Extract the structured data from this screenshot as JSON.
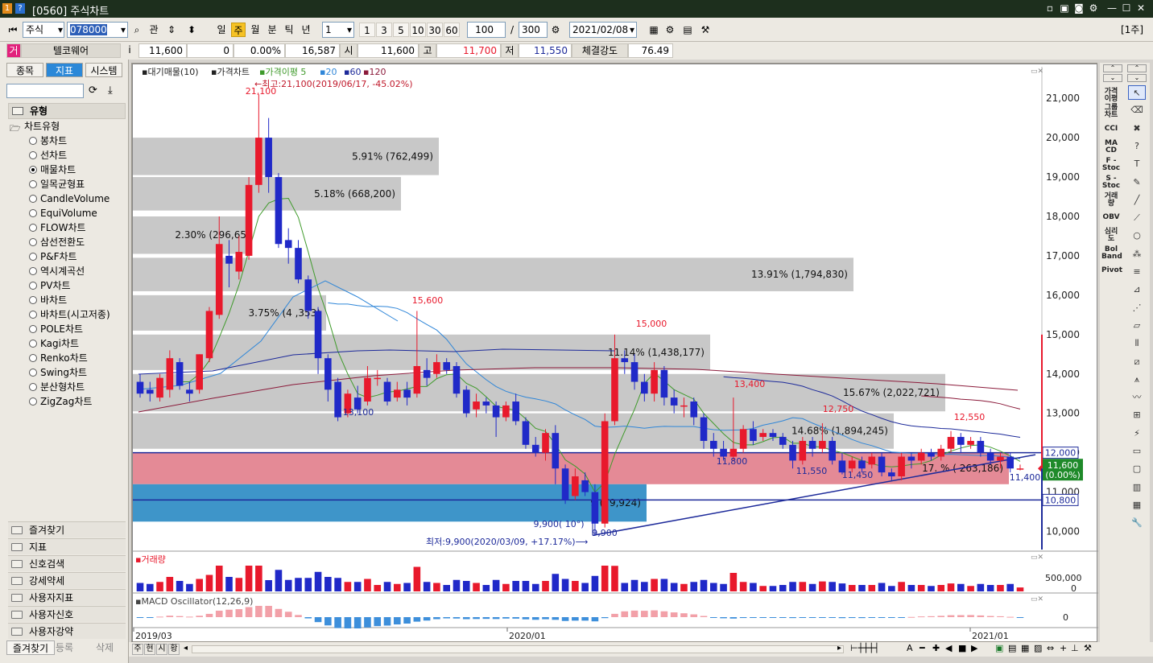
{
  "window": {
    "title": "[0560] 주식차트"
  },
  "toolbar": {
    "market": "주식",
    "code": "078000",
    "btn_gwan": "관",
    "periods": [
      "일",
      "주",
      "월",
      "분",
      "틱",
      "년"
    ],
    "active_period": "주",
    "interval": "1",
    "quick_intervals": [
      "1",
      "3",
      "5",
      "10",
      "30",
      "60"
    ],
    "count": "100",
    "total": "300",
    "date": "2021/02/08",
    "right_tag": "[1주]"
  },
  "quote": {
    "badge": "거",
    "name": "텔코웨어",
    "info": "i",
    "price": "11,600",
    "change": "0",
    "rate": "0.00%",
    "volume": "16,587",
    "open_label": "시",
    "open": "11,600",
    "high_label": "고",
    "high": "11,700",
    "low_label": "저",
    "low": "11,550",
    "strength_label": "체결강도",
    "strength": "76.49"
  },
  "left": {
    "tabs": [
      "종목",
      "지표",
      "시스템"
    ],
    "active_tab": "지표",
    "section": "유형",
    "group": "차트유형",
    "types": [
      "봉차트",
      "선차트",
      "매물차트",
      "일목균형표",
      "CandleVolume",
      "EquiVolume",
      "FLOW차트",
      "삼선전환도",
      "P&F차트",
      "역시계곡선",
      "PV차트",
      "바차트",
      "바차트(시고저종)",
      "POLE차트",
      "Kagi차트",
      "Renko차트",
      "Swing차트",
      "분산형차트",
      "ZigZag차트"
    ],
    "selected_type": "매물차트",
    "accordions": [
      "즐겨찾기",
      "지표",
      "신호검색",
      "강세약세",
      "사용자지표",
      "사용자신호",
      "사용자강약"
    ],
    "bottom_tabs": [
      "즐겨찾기",
      "등록",
      "삭제"
    ]
  },
  "chart": {
    "legend": [
      "▪대기매물(10)",
      "▪가격차트",
      "▪가격이평 5",
      "▪20",
      "▪60",
      "▪120"
    ],
    "max_note": "←최고:21,100(2019/06/17, -45.02%)",
    "min_note": "최저:9,900(2020/03/09, +17.17%)⟶",
    "y_ticks": [
      "21,000",
      "20,000",
      "19,000",
      "18,000",
      "17,000",
      "16,000",
      "15,000",
      "14,000",
      "13,000",
      "12,000",
      "11,000",
      "10,000"
    ],
    "x_ticks": [
      "2019/03",
      "2020/01",
      "2021/01"
    ],
    "price_tags": {
      "top": "12,000",
      "cur": "11,600",
      "cur_rate": "(0.00%)",
      "low": "10,800"
    },
    "volume_title": "▪거래량",
    "volume_ticks": [
      "500,000",
      "0"
    ],
    "macd_title": "▪MACD Oscillator(12,26,9)",
    "macd_tick": "0",
    "profile": [
      {
        "label": "5.91% (762,499)"
      },
      {
        "label": "5.18% (668,200)"
      },
      {
        "label": "2.30% (296,65"
      },
      {
        "label": "13.91% (1,794,830)"
      },
      {
        "label": "3.75% (4 ,353)"
      },
      {
        "label": "11.14% (1,438,177)"
      },
      {
        "label": "15.67% (2,022,721)"
      },
      {
        "label": "14.68% (1,894,245)"
      },
      {
        "label": "17.  % ( 263,186)"
      },
      {
        "label": "9  (79,924)"
      }
    ],
    "annotations": [
      "21,100",
      "15,600",
      "15,000",
      "13,400",
      "12,750",
      "12,550",
      "13,100",
      "11,800",
      "11,550",
      "11,450",
      "11,400",
      "9,900( 10°)",
      "9,900"
    ],
    "colors": {
      "up": "#e8192c",
      "down": "#2029c8",
      "ma5": "#3f9a2b",
      "ma20": "#2f86d8",
      "ma60": "#1d2a9a",
      "ma120": "#8b1a3a"
    }
  },
  "chart_data": {
    "type": "candlestick",
    "title": "",
    "ylim": [
      9500,
      21800
    ],
    "candles": [
      {
        "o": 13800,
        "c": 13500,
        "h": 14000,
        "l": 13400
      },
      {
        "o": 13600,
        "c": 13500,
        "h": 13800,
        "l": 13300
      },
      {
        "o": 13400,
        "c": 13900,
        "h": 14000,
        "l": 13300
      },
      {
        "o": 13600,
        "c": 14400,
        "h": 14600,
        "l": 13400
      },
      {
        "o": 14300,
        "c": 13700,
        "h": 14400,
        "l": 13600
      },
      {
        "o": 13600,
        "c": 13500,
        "h": 13800,
        "l": 13300
      },
      {
        "o": 13600,
        "c": 14500,
        "h": 14500,
        "l": 13500
      },
      {
        "o": 14400,
        "c": 15600,
        "h": 15700,
        "l": 14300
      },
      {
        "o": 15500,
        "c": 17300,
        "h": 18000,
        "l": 15400
      },
      {
        "o": 17000,
        "c": 16800,
        "h": 17400,
        "l": 16200
      },
      {
        "o": 16600,
        "c": 17100,
        "h": 17500,
        "l": 16400
      },
      {
        "o": 17000,
        "c": 18800,
        "h": 19000,
        "l": 16900
      },
      {
        "o": 18800,
        "c": 20000,
        "h": 21100,
        "l": 18600
      },
      {
        "o": 20000,
        "c": 19000,
        "h": 20500,
        "l": 18600
      },
      {
        "o": 19000,
        "c": 17300,
        "h": 19100,
        "l": 17200
      },
      {
        "o": 17400,
        "c": 17200,
        "h": 17700,
        "l": 16800
      },
      {
        "o": 17200,
        "c": 16400,
        "h": 17400,
        "l": 16300
      },
      {
        "o": 16400,
        "c": 15600,
        "h": 16500,
        "l": 15400
      },
      {
        "o": 15600,
        "c": 14400,
        "h": 15700,
        "l": 14000
      },
      {
        "o": 14400,
        "c": 13600,
        "h": 14500,
        "l": 13300
      },
      {
        "o": 13800,
        "c": 12900,
        "h": 13900,
        "l": 12800
      },
      {
        "o": 13000,
        "c": 13500,
        "h": 13600,
        "l": 12900
      },
      {
        "o": 13400,
        "c": 13100,
        "h": 13700,
        "l": 13000
      },
      {
        "o": 13300,
        "c": 13900,
        "h": 14200,
        "l": 13200
      },
      {
        "o": 13900,
        "c": 13900,
        "h": 14100,
        "l": 13700
      },
      {
        "o": 13800,
        "c": 13300,
        "h": 13900,
        "l": 13200
      },
      {
        "o": 13400,
        "c": 13600,
        "h": 13800,
        "l": 13300
      },
      {
        "o": 13600,
        "c": 13400,
        "h": 13800,
        "l": 13200
      },
      {
        "o": 13500,
        "c": 14200,
        "h": 15600,
        "l": 13400
      },
      {
        "o": 14100,
        "c": 13900,
        "h": 14400,
        "l": 13700
      },
      {
        "o": 14000,
        "c": 14300,
        "h": 14500,
        "l": 13900
      },
      {
        "o": 14300,
        "c": 14100,
        "h": 14400,
        "l": 14000
      },
      {
        "o": 14200,
        "c": 13500,
        "h": 14300,
        "l": 13400
      },
      {
        "o": 13600,
        "c": 13000,
        "h": 13700,
        "l": 12900
      },
      {
        "o": 13100,
        "c": 13300,
        "h": 13500,
        "l": 12900
      },
      {
        "o": 13300,
        "c": 13200,
        "h": 13400,
        "l": 13000
      },
      {
        "o": 13200,
        "c": 12900,
        "h": 13300,
        "l": 12400
      },
      {
        "o": 12900,
        "c": 13200,
        "h": 13300,
        "l": 12800
      },
      {
        "o": 13300,
        "c": 12800,
        "h": 13500,
        "l": 12700
      },
      {
        "o": 12800,
        "c": 12200,
        "h": 12900,
        "l": 12100
      },
      {
        "o": 12200,
        "c": 12000,
        "h": 12400,
        "l": 11900
      },
      {
        "o": 12000,
        "c": 12500,
        "h": 12600,
        "l": 11800
      },
      {
        "o": 12500,
        "c": 11600,
        "h": 12700,
        "l": 11200
      },
      {
        "o": 11600,
        "c": 10800,
        "h": 11700,
        "l": 10700
      },
      {
        "o": 10900,
        "c": 11400,
        "h": 11600,
        "l": 10800
      },
      {
        "o": 11300,
        "c": 11000,
        "h": 11500,
        "l": 10900
      },
      {
        "o": 11000,
        "c": 10200,
        "h": 11200,
        "l": 9900
      },
      {
        "o": 10200,
        "c": 12800,
        "h": 13000,
        "l": 10100
      },
      {
        "o": 12800,
        "c": 14400,
        "h": 15000,
        "l": 12700
      },
      {
        "o": 14400,
        "c": 14300,
        "h": 14600,
        "l": 14000
      },
      {
        "o": 14300,
        "c": 13800,
        "h": 14500,
        "l": 13600
      },
      {
        "o": 13800,
        "c": 13500,
        "h": 14000,
        "l": 13300
      },
      {
        "o": 13500,
        "c": 14100,
        "h": 14300,
        "l": 13300
      },
      {
        "o": 14100,
        "c": 13400,
        "h": 14200,
        "l": 13200
      },
      {
        "o": 13400,
        "c": 13200,
        "h": 13600,
        "l": 13000
      },
      {
        "o": 13200,
        "c": 13200,
        "h": 13400,
        "l": 12900
      },
      {
        "o": 13300,
        "c": 12900,
        "h": 13400,
        "l": 12700
      },
      {
        "o": 12900,
        "c": 12300,
        "h": 13000,
        "l": 12100
      },
      {
        "o": 12300,
        "c": 12100,
        "h": 12500,
        "l": 11900
      },
      {
        "o": 12100,
        "c": 11900,
        "h": 12300,
        "l": 11800
      },
      {
        "o": 11900,
        "c": 12100,
        "h": 13400,
        "l": 11800
      },
      {
        "o": 12100,
        "c": 12600,
        "h": 12700,
        "l": 12000
      },
      {
        "o": 12600,
        "c": 12300,
        "h": 12800,
        "l": 12200
      },
      {
        "o": 12400,
        "c": 12500,
        "h": 12600,
        "l": 12300
      },
      {
        "o": 12500,
        "c": 12400,
        "h": 12600,
        "l": 12300
      },
      {
        "o": 12400,
        "c": 12200,
        "h": 12500,
        "l": 12100
      },
      {
        "o": 12200,
        "c": 11800,
        "h": 12300,
        "l": 11600
      },
      {
        "o": 11800,
        "c": 12300,
        "h": 12400,
        "l": 11700
      },
      {
        "o": 12300,
        "c": 12100,
        "h": 12400,
        "l": 11900
      },
      {
        "o": 12100,
        "c": 12300,
        "h": 12750,
        "l": 12000
      },
      {
        "o": 12300,
        "c": 11800,
        "h": 12400,
        "l": 11700
      },
      {
        "o": 11800,
        "c": 11500,
        "h": 12000,
        "l": 11450
      },
      {
        "o": 11600,
        "c": 11800,
        "h": 11900,
        "l": 11500
      },
      {
        "o": 11800,
        "c": 11600,
        "h": 11900,
        "l": 11500
      },
      {
        "o": 11700,
        "c": 11900,
        "h": 12000,
        "l": 11600
      },
      {
        "o": 11900,
        "c": 11500,
        "h": 12000,
        "l": 11400
      },
      {
        "o": 11500,
        "c": 11400,
        "h": 11600,
        "l": 11300
      },
      {
        "o": 11400,
        "c": 11900,
        "h": 12000,
        "l": 11300
      },
      {
        "o": 11900,
        "c": 11800,
        "h": 12000,
        "l": 11600
      },
      {
        "o": 11800,
        "c": 12000,
        "h": 12100,
        "l": 11700
      },
      {
        "o": 12000,
        "c": 11900,
        "h": 12100,
        "l": 11800
      },
      {
        "o": 11900,
        "c": 12100,
        "h": 12200,
        "l": 11800
      },
      {
        "o": 12100,
        "c": 12400,
        "h": 12550,
        "l": 12000
      },
      {
        "o": 12400,
        "c": 12200,
        "h": 12500,
        "l": 12000
      },
      {
        "o": 12200,
        "c": 12300,
        "h": 12400,
        "l": 12100
      },
      {
        "o": 12300,
        "c": 12000,
        "h": 12400,
        "l": 11900
      },
      {
        "o": 12000,
        "c": 11800,
        "h": 12100,
        "l": 11700
      },
      {
        "o": 11800,
        "c": 11900,
        "h": 12000,
        "l": 11600
      },
      {
        "o": 11900,
        "c": 11600,
        "h": 12000,
        "l": 11500
      },
      {
        "o": 11600,
        "c": 11600,
        "h": 11700,
        "l": 11550
      }
    ]
  }
}
